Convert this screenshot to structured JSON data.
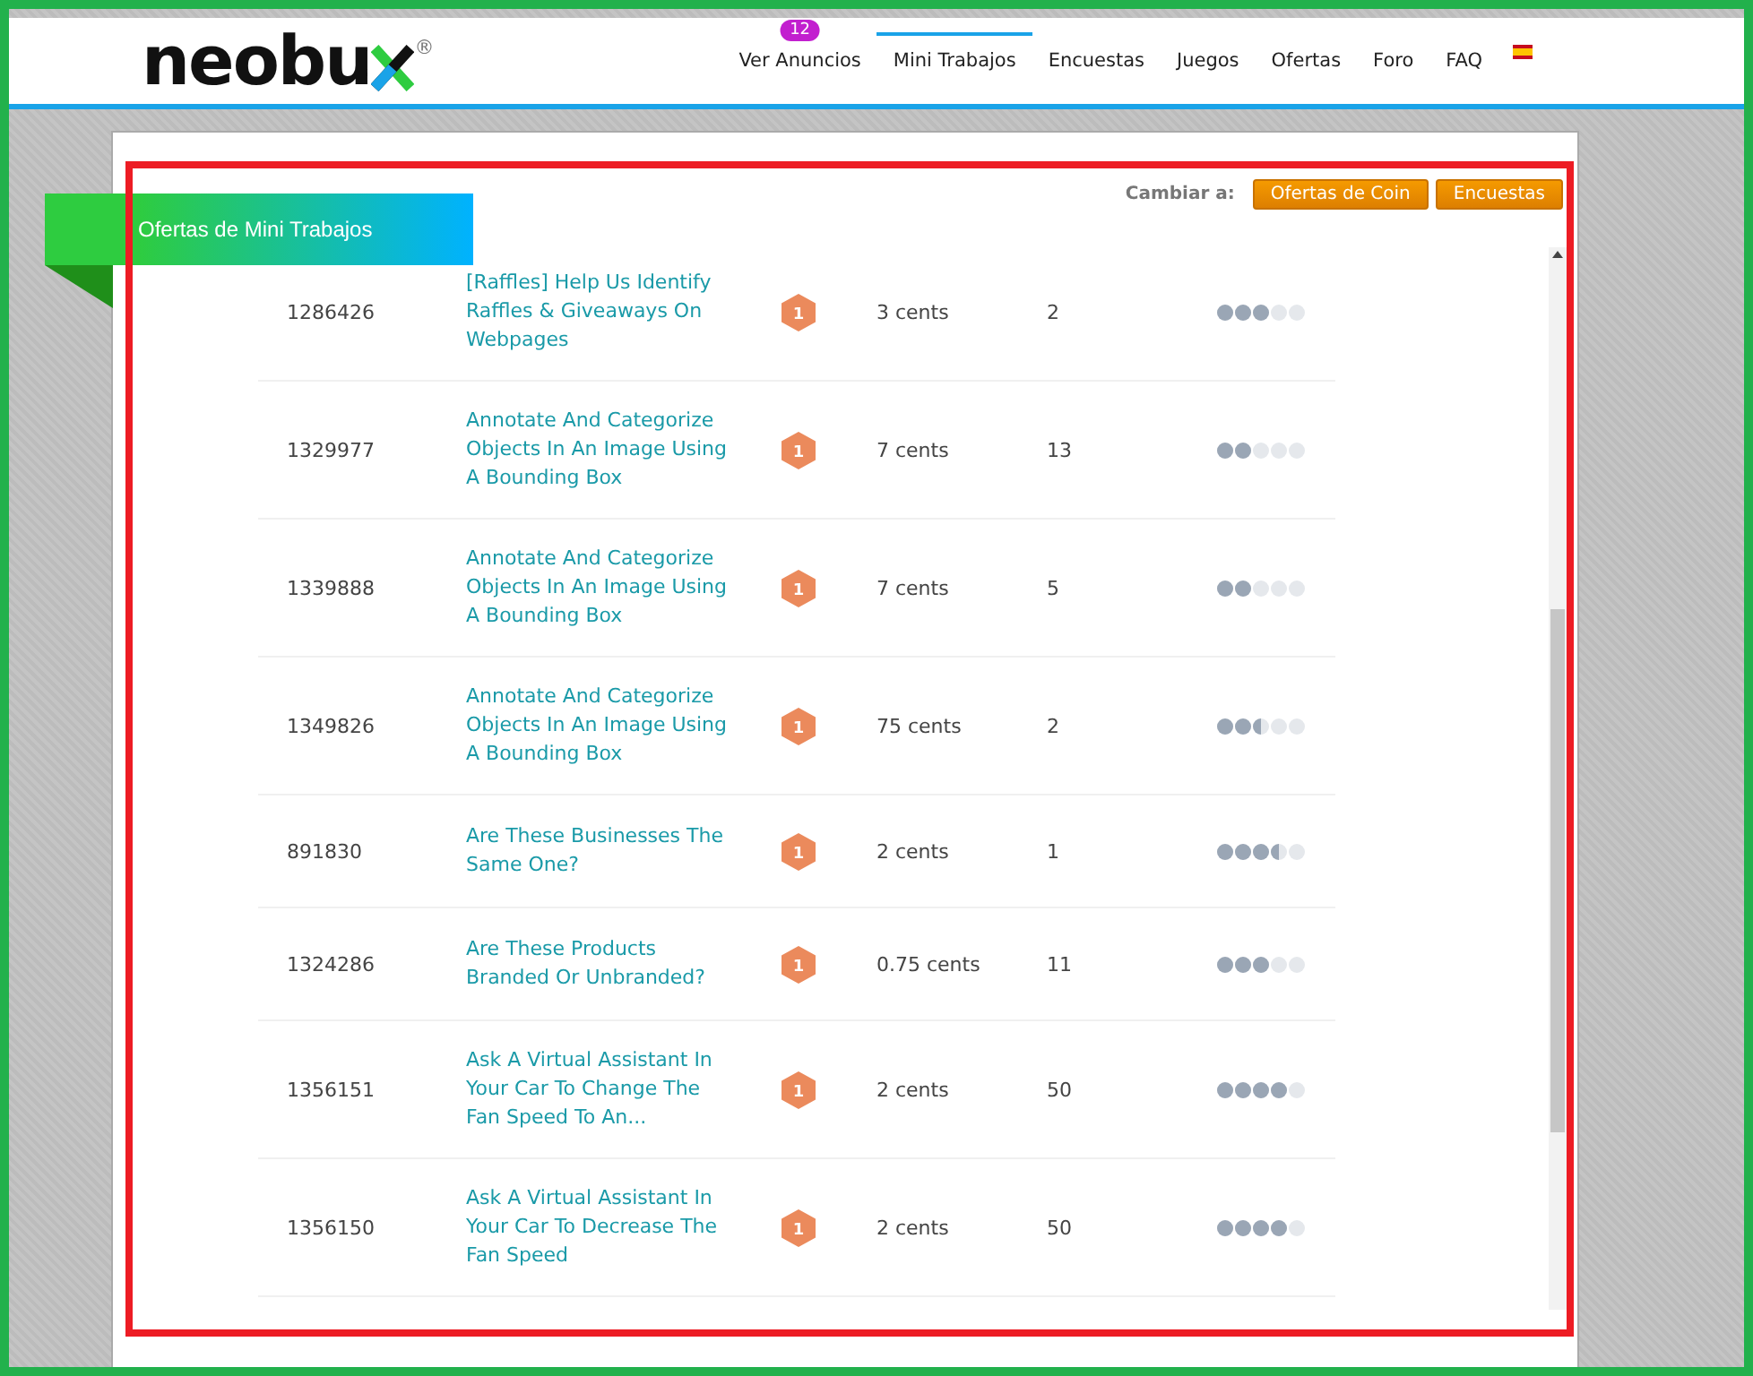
{
  "header": {
    "logo": "neobu",
    "logo_mark": "®",
    "nav": [
      {
        "label": "Ver Anuncios",
        "selected": false,
        "badge": "12"
      },
      {
        "label": "Mini Trabajos",
        "selected": true
      },
      {
        "label": "Encuestas",
        "selected": false
      },
      {
        "label": "Juegos",
        "selected": false
      },
      {
        "label": "Ofertas",
        "selected": false
      },
      {
        "label": "Foro",
        "selected": false
      },
      {
        "label": "FAQ",
        "selected": false
      }
    ]
  },
  "panel": {
    "title": "Ofertas de Mini Trabajos",
    "switch_label": "Cambiar a:",
    "switch_buttons": [
      "Ofertas de Coin",
      "Encuestas"
    ],
    "rows": [
      {
        "id": "1286426",
        "title": "[Raffles] Help Us Identify Raffles & Giveaways On Webpages",
        "level_badge": "1",
        "reward": "3 cents",
        "count": "2",
        "stars": 3
      },
      {
        "id": "1329977",
        "title": "Annotate And Categorize Objects In An Image Using A Bounding Box",
        "level_badge": "1",
        "reward": "7 cents",
        "count": "13",
        "stars": 2
      },
      {
        "id": "1339888",
        "title": "Annotate And Categorize Objects In An Image Using A Bounding Box",
        "level_badge": "1",
        "reward": "7 cents",
        "count": "5",
        "stars": 2
      },
      {
        "id": "1349826",
        "title": "Annotate And Categorize Objects In An Image Using A Bounding Box",
        "level_badge": "1",
        "reward": "75 cents",
        "count": "2",
        "stars": 2.5
      },
      {
        "id": "891830",
        "title": "Are These Businesses The Same One?",
        "level_badge": "1",
        "reward": "2 cents",
        "count": "1",
        "stars": 3.5
      },
      {
        "id": "1324286",
        "title": "Are These Products Branded Or Unbranded?",
        "level_badge": "1",
        "reward": "0.75 cents",
        "count": "11",
        "stars": 3
      },
      {
        "id": "1356151",
        "title": "Ask A Virtual Assistant In Your Car To Change The Fan Speed To An...",
        "level_badge": "1",
        "reward": "2 cents",
        "count": "50",
        "stars": 4
      },
      {
        "id": "1356150",
        "title": "Ask A Virtual Assistant In Your Car To Decrease The Fan Speed",
        "level_badge": "1",
        "reward": "2 cents",
        "count": "50",
        "stars": 4
      }
    ]
  }
}
